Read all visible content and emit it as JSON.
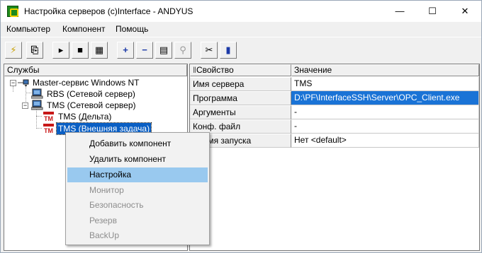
{
  "window": {
    "title": "Настройка серверов (c)Interface - ANDYUS",
    "minimize_glyph": "—",
    "maximize_glyph": "☐",
    "close_glyph": "✕"
  },
  "menubar": {
    "items": [
      "Компьютер",
      "Компонент",
      "Помощь"
    ]
  },
  "toolbar": {
    "buttons": [
      {
        "name": "connect-button",
        "icon": "lightning-icon",
        "glyph": "⚡"
      },
      {
        "name": "copy-button",
        "icon": "copy-icon",
        "glyph": "⎘"
      },
      {
        "name": "play-button",
        "icon": "play-icon",
        "glyph": "▸"
      },
      {
        "name": "stop-button",
        "icon": "stop-icon",
        "glyph": "■"
      },
      {
        "name": "components-button",
        "icon": "chip-icon",
        "glyph": "▦"
      },
      {
        "name": "add-button",
        "icon": "plus-icon",
        "glyph": "+"
      },
      {
        "name": "remove-button",
        "icon": "minus-icon",
        "glyph": "−"
      },
      {
        "name": "properties-button",
        "icon": "properties-icon",
        "glyph": "▤"
      },
      {
        "name": "search-button",
        "icon": "magnifier-icon",
        "glyph": "⚲"
      },
      {
        "name": "tools-button",
        "icon": "tools-icon",
        "glyph": "✂"
      },
      {
        "name": "help-button",
        "icon": "help-book-icon",
        "glyph": "▮"
      }
    ]
  },
  "tree": {
    "header": "Службы",
    "nodes": [
      {
        "label": "Master-сервис Windows NT",
        "icon": "network-icon",
        "expander": "−"
      },
      {
        "label": "RBS (Сетевой сервер)",
        "icon": "computer-icon",
        "expander": ""
      },
      {
        "label": "TMS (Сетевой сервер)",
        "icon": "computer-icon",
        "expander": "−"
      },
      {
        "label": "TMS (Дельта)",
        "icon": "tm-icon",
        "tm": "TM"
      },
      {
        "label": "TMS (Внешняя задача)",
        "icon": "tm-icon",
        "tm": "TM"
      }
    ]
  },
  "properties": {
    "header_key": "Свойство",
    "header_value": "Значение",
    "rows": [
      {
        "key": "Имя сервера",
        "value": "TMS"
      },
      {
        "key": "Программа",
        "value": "D:\\PF\\InterfaceSSH\\Server\\OPC_Client.exe"
      },
      {
        "key": "Аргументы",
        "value": "-"
      },
      {
        "key": "Конф. файл",
        "value": "-"
      },
      {
        "key": "Время запуска",
        "value": "Нет <default>"
      }
    ]
  },
  "context_menu": {
    "items": [
      {
        "label": "Добавить компонент",
        "enabled": true
      },
      {
        "label": "Удалить компонент",
        "enabled": true
      },
      {
        "label": "Настройка",
        "enabled": true,
        "highlighted": true
      },
      {
        "label": "Монитор",
        "enabled": false
      },
      {
        "label": "Безопасность",
        "enabled": false
      },
      {
        "label": "Резерв",
        "enabled": false
      },
      {
        "label": "BackUp",
        "enabled": false
      }
    ]
  },
  "colors": {
    "selection": "#0a5fc4",
    "menu_highlight": "#99c9ef",
    "value_highlight": "#1a73d6",
    "tm_icon": "#c81818"
  }
}
